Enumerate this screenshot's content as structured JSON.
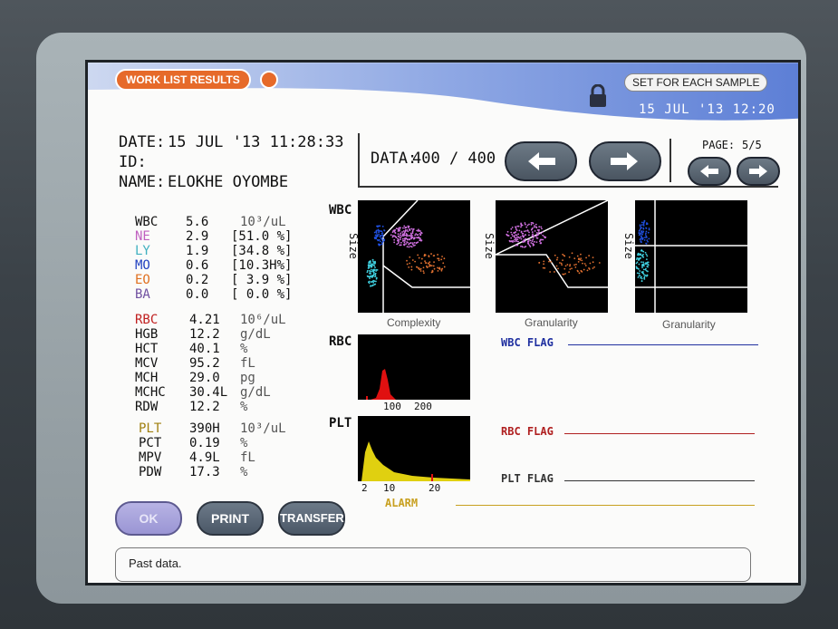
{
  "header": {
    "title": "WORK LIST RESULTS",
    "mode_label": "SET FOR EACH SAMPLE",
    "datetime": "15 JUL '13  12:20"
  },
  "patient": {
    "date_label": "DATE:",
    "date_value": "15 JUL '13 11:28:33",
    "id_label": "ID:",
    "id_value": "",
    "name_label": "NAME:",
    "name_value": "ELOKHE OYOMBE"
  },
  "data_nav": {
    "data_label": "DATA:",
    "data_value": "400 / 400",
    "page_label": "PAGE:",
    "page_value": "5/5"
  },
  "wbc_params": [
    {
      "name": "WBC",
      "value": "5.6",
      "pct": "",
      "unit": "10³/uL",
      "color": "#111111"
    },
    {
      "name": "NE",
      "value": "2.9",
      "pct": "[51.0 %]",
      "unit": "",
      "color": "#c060c0"
    },
    {
      "name": "LY",
      "value": "1.9",
      "pct": "[34.8 %]",
      "unit": "",
      "color": "#40b0c0"
    },
    {
      "name": "MO",
      "value": "0.6",
      "pct": "[10.3H%]",
      "unit": "",
      "color": "#2040c0"
    },
    {
      "name": "EO",
      "value": "0.2",
      "pct": "[ 3.9 %]",
      "unit": "",
      "color": "#e07020"
    },
    {
      "name": "BA",
      "value": "0.0",
      "pct": "[ 0.0 %]",
      "unit": "",
      "color": "#7050a0"
    }
  ],
  "rbc_params": [
    {
      "name": "RBC",
      "value": "4.21",
      "unit": "10⁶/uL",
      "color": "#c02020"
    },
    {
      "name": "HGB",
      "value": "12.2",
      "unit": "g/dL",
      "color": "#111111"
    },
    {
      "name": "HCT",
      "value": "40.1",
      "unit": "%",
      "color": "#111111"
    },
    {
      "name": "MCV",
      "value": "95.2",
      "unit": "fL",
      "color": "#111111"
    },
    {
      "name": "MCH",
      "value": "29.0",
      "unit": "pg",
      "color": "#111111"
    },
    {
      "name": "MCHC",
      "value": "30.4L",
      "unit": "g/dL",
      "color": "#111111"
    },
    {
      "name": "RDW",
      "value": "12.2",
      "unit": "%",
      "color": "#111111"
    }
  ],
  "plt_params": [
    {
      "name": "PLT",
      "value": "390H",
      "unit": "10³/uL",
      "color": "#a08010"
    },
    {
      "name": "PCT",
      "value": "0.19",
      "unit": "%",
      "color": "#111111"
    },
    {
      "name": "MPV",
      "value": "4.9L",
      "unit": "fL",
      "color": "#111111"
    },
    {
      "name": "PDW",
      "value": "17.3",
      "unit": "%",
      "color": "#111111"
    }
  ],
  "scatter": {
    "section_label": "WBC",
    "size_axis": "Size",
    "plot1_xlabel": "Complexity",
    "plot2_xlabel": "Granularity",
    "plot3_xlabel": "Granularity"
  },
  "rbc_hist": {
    "label": "RBC",
    "ticks": [
      "100",
      "200"
    ],
    "color": "#e01010"
  },
  "plt_hist": {
    "label": "PLT",
    "ticks": [
      "2",
      "10",
      "20"
    ],
    "color": "#e0d010"
  },
  "flags": {
    "wbc": "WBC FLAG",
    "rbc": "RBC FLAG",
    "plt": "PLT FLAG",
    "alarm": "ALARM",
    "wbc_color": "#2030a0",
    "rbc_color": "#b02020",
    "plt_color": "#333333",
    "alarm_color": "#c8a020"
  },
  "buttons": {
    "ok": "OK",
    "print": "PRINT",
    "transfer": "TRANSFER"
  },
  "status": {
    "message": "Past data."
  },
  "colors": {
    "accent": "#e66a2a",
    "header_blue": "#6f8fd8"
  }
}
